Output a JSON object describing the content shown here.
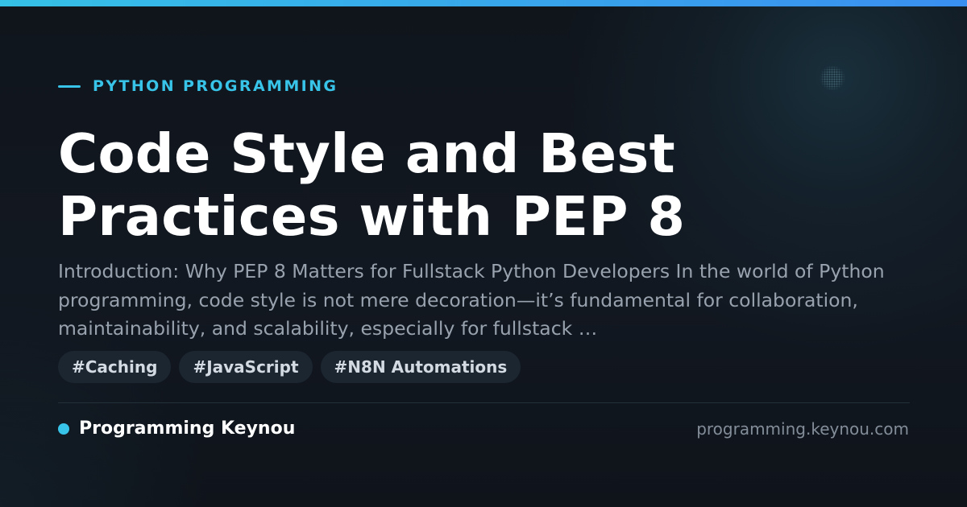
{
  "category": "PYTHON PROGRAMMING",
  "title": "Code Style and Best Practices with PEP 8",
  "excerpt": "Introduction: Why PEP 8 Matters for Fullstack Python Developers In the world of Python programming, code style is not mere decoration—it’s fundamental for collaboration, maintainability, and scalability, especially for fullstack …",
  "tags": [
    "#Caching",
    "#JavaScript",
    "#N8N Automations"
  ],
  "footer": {
    "brand": "Programming Keynou",
    "url": "programming.keynou.com"
  },
  "colors": {
    "accent": "#38c3e8",
    "background": "#10151c",
    "title": "#ffffff",
    "excerpt": "#98a2ae",
    "tag_bg": "#1c2631"
  }
}
